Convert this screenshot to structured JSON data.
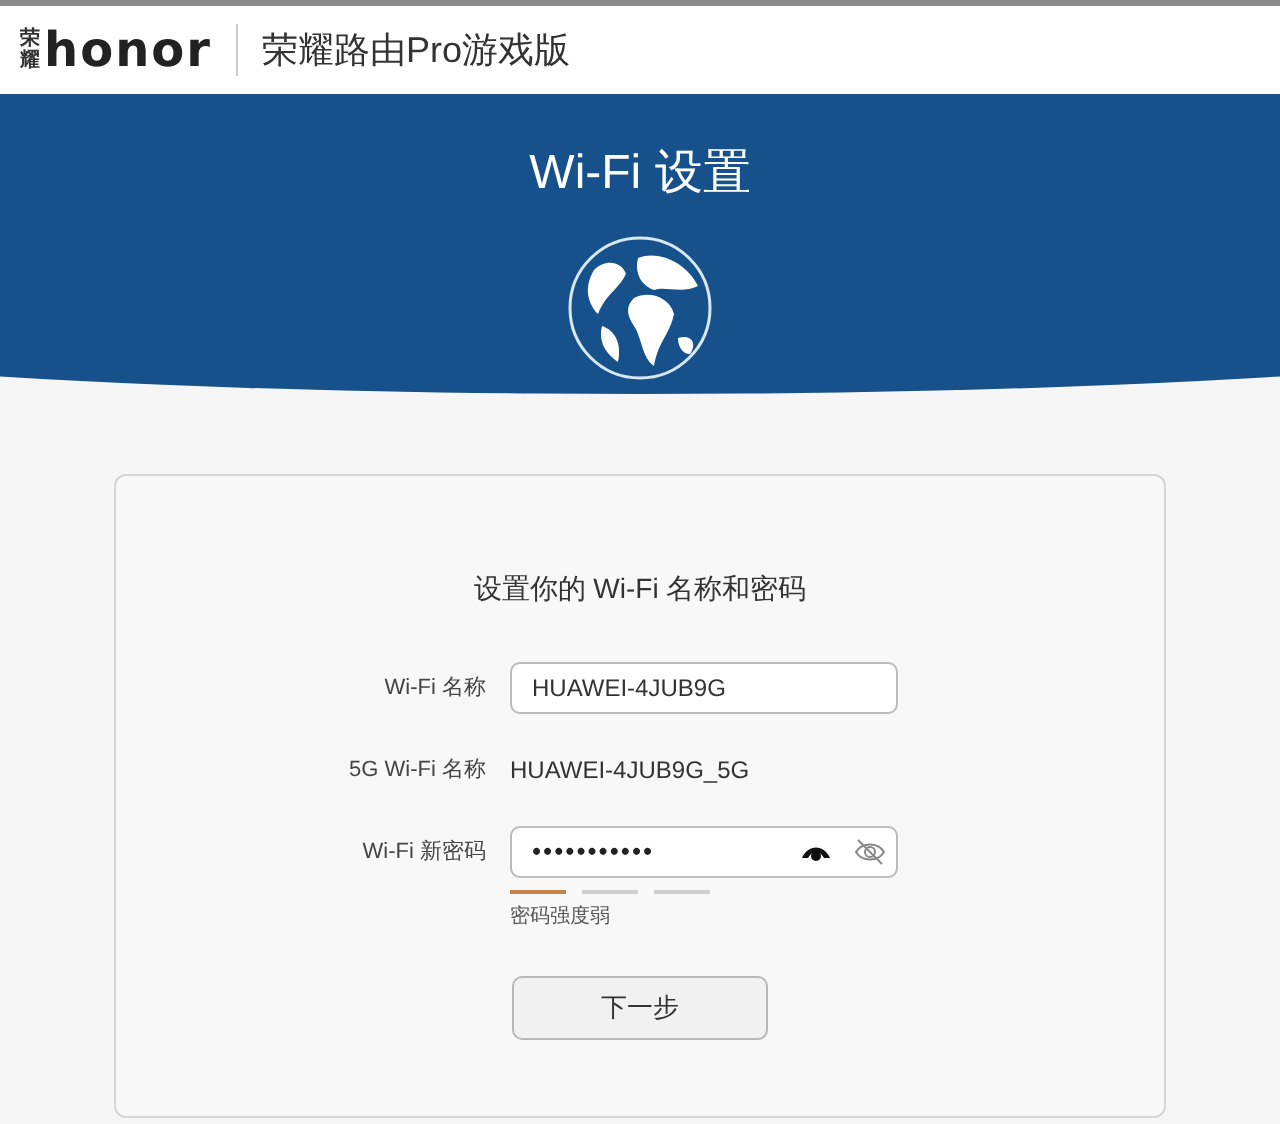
{
  "top_bar": {
    "logo_small": "荣耀",
    "logo": "honor",
    "title": "荣耀路由Pro游戏版"
  },
  "banner": {
    "title": "Wi-Fi 设置"
  },
  "form": {
    "heading": "设置你的 Wi-Fi 名称和密码",
    "fields": [
      {
        "kind": "input",
        "label": "Wi-Fi 名称",
        "value": "HUAWEI-4JUB9G"
      },
      {
        "kind": "text",
        "label": "5G Wi-Fi 名称",
        "value": "HUAWEI-4JUB9G_5G"
      },
      {
        "kind": "password",
        "label": "Wi-Fi 新密码",
        "value": "•••••••••••"
      }
    ],
    "strength": {
      "segments": [
        {
          "on": true
        },
        {
          "on": false
        },
        {
          "on": false
        }
      ],
      "label": "密码强度弱"
    },
    "next_button": "下一步"
  }
}
